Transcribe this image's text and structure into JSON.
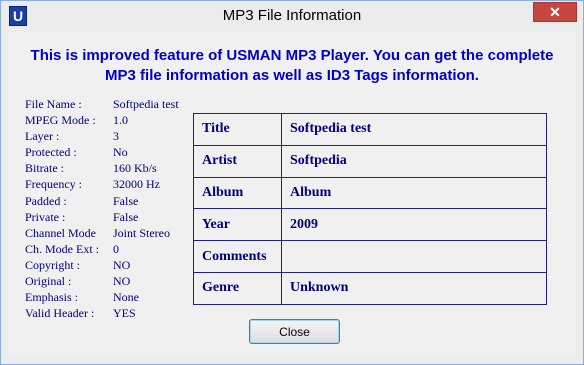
{
  "window": {
    "title": "MP3 File Information",
    "close_glyph": "✕",
    "app_icon_letter": "U"
  },
  "headline": {
    "line1": "This is improved feature of USMAN MP3 Player. You can get the complete",
    "line2": "MP3 file information as well as ID3 Tags information."
  },
  "file_info": [
    {
      "label": "File Name :",
      "value": "Softpedia test"
    },
    {
      "label": "MPEG Mode :",
      "value": "1.0"
    },
    {
      "label": "Layer :",
      "value": "3"
    },
    {
      "label": "Protected :",
      "value": "No"
    },
    {
      "label": "Bitrate :",
      "value": "160  Kb/s"
    },
    {
      "label": "Frequency :",
      "value": "32000  Hz"
    },
    {
      "label": "Padded :",
      "value": "False"
    },
    {
      "label": "Private :",
      "value": "False"
    },
    {
      "label": "Channel Mode",
      "value": "Joint Stereo"
    },
    {
      "label": "Ch. Mode Ext :",
      "value": "0"
    },
    {
      "label": "Copyright :",
      "value": "NO"
    },
    {
      "label": "Original :",
      "value": "NO"
    },
    {
      "label": "Emphasis :",
      "value": "None"
    },
    {
      "label": "Valid Header  :",
      "value": "YES"
    }
  ],
  "id3_tags": [
    {
      "key": "Title",
      "value": "Softpedia test"
    },
    {
      "key": "Artist",
      "value": "Softpedia"
    },
    {
      "key": "Album",
      "value": "Album"
    },
    {
      "key": "Year",
      "value": "2009"
    },
    {
      "key": "Comments",
      "value": ""
    },
    {
      "key": "Genre",
      "value": "Unknown"
    }
  ],
  "buttons": {
    "close_label": "Close"
  }
}
